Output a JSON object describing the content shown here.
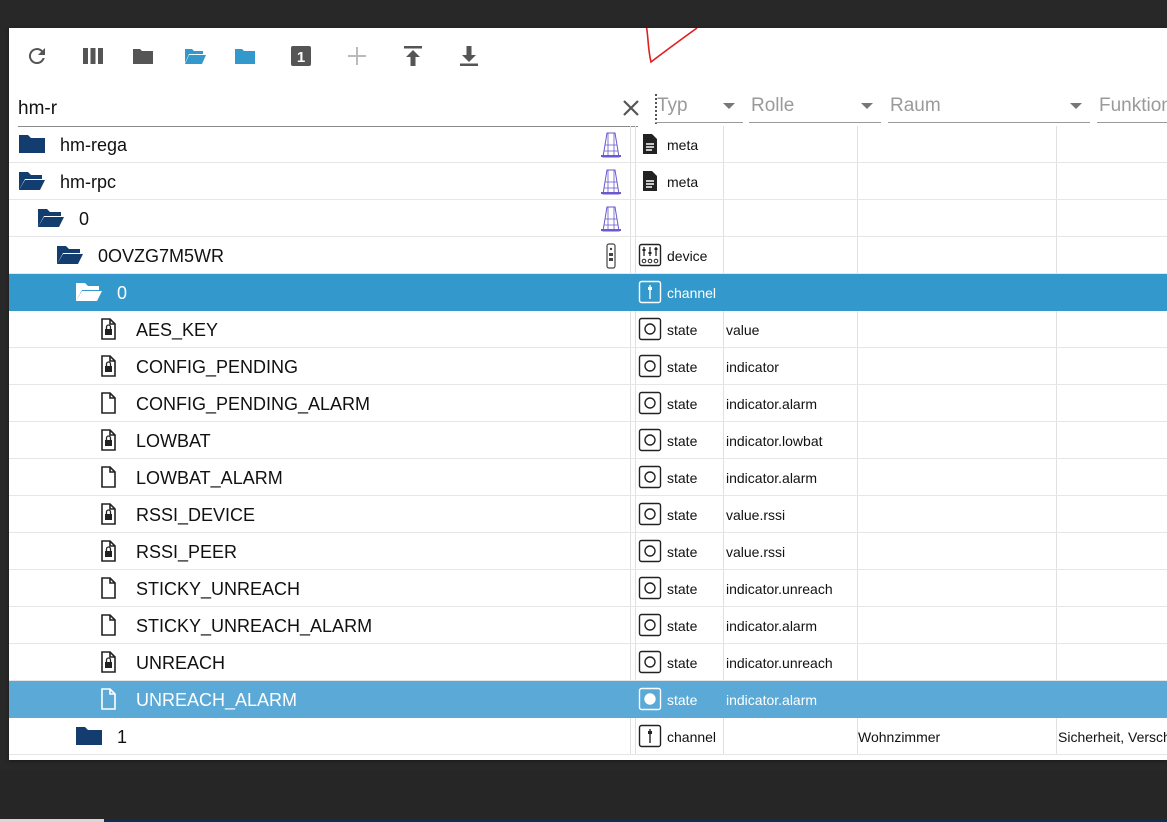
{
  "toolbar": {
    "buttons": [
      {
        "name": "refresh",
        "icon": "refresh-icon"
      },
      {
        "name": "columns",
        "icon": "columns-icon"
      },
      {
        "name": "collapse-all",
        "icon": "folder-closed-icon"
      },
      {
        "name": "expand-all",
        "icon": "folder-open-icon"
      },
      {
        "name": "expand-one",
        "icon": "folder-blue-icon"
      },
      {
        "name": "level",
        "icon": "number-one-icon",
        "label": "1"
      },
      {
        "name": "add",
        "icon": "plus-icon"
      },
      {
        "name": "upload",
        "icon": "upload-icon"
      },
      {
        "name": "download",
        "icon": "download-icon"
      }
    ]
  },
  "search": {
    "value": "hm-r"
  },
  "filters": {
    "type_placeholder": "Typ",
    "role_placeholder": "Rolle",
    "room_placeholder": "Raum",
    "function_placeholder": "Funktion"
  },
  "colors": {
    "folder": "#123d6e",
    "selected_dark": "#3399cc",
    "selected_light": "#5aa9d6",
    "annotation": "#e02020"
  },
  "rows": [
    {
      "name": "hm-rega",
      "kind": "folder-closed",
      "type": "meta",
      "type_icon": "document-icon",
      "role": "",
      "room": "",
      "func": "",
      "adapter_icon": "rega-icon"
    },
    {
      "name": "hm-rpc",
      "kind": "folder-open",
      "type": "meta",
      "type_icon": "document-icon",
      "role": "",
      "room": "",
      "func": "",
      "adapter_icon": "rpc-icon"
    },
    {
      "name": "0",
      "kind": "folder-open",
      "type": "",
      "type_icon": "",
      "role": "",
      "room": "",
      "func": "",
      "adapter_icon": "rpc-icon"
    },
    {
      "name": "0OVZG7M5WR",
      "kind": "folder-open",
      "type": "device",
      "type_icon": "device-icon",
      "role": "",
      "room": "",
      "func": "",
      "adapter_icon": "device-remote-icon"
    },
    {
      "name": "0",
      "kind": "folder-open",
      "type": "channel",
      "type_icon": "channel-icon",
      "role": "",
      "room": "",
      "func": "",
      "selected": "dark"
    },
    {
      "name": "AES_KEY",
      "kind": "file-lock",
      "type": "state",
      "type_icon": "state-icon",
      "role": "value",
      "room": "",
      "func": ""
    },
    {
      "name": "CONFIG_PENDING",
      "kind": "file-lock",
      "type": "state",
      "type_icon": "state-icon",
      "role": "indicator",
      "room": "",
      "func": ""
    },
    {
      "name": "CONFIG_PENDING_ALARM",
      "kind": "file",
      "type": "state",
      "type_icon": "state-icon",
      "role": "indicator.alarm",
      "room": "",
      "func": ""
    },
    {
      "name": "LOWBAT",
      "kind": "file-lock",
      "type": "state",
      "type_icon": "state-icon",
      "role": "indicator.lowbat",
      "room": "",
      "func": ""
    },
    {
      "name": "LOWBAT_ALARM",
      "kind": "file",
      "type": "state",
      "type_icon": "state-icon",
      "role": "indicator.alarm",
      "room": "",
      "func": ""
    },
    {
      "name": "RSSI_DEVICE",
      "kind": "file-lock",
      "type": "state",
      "type_icon": "state-icon",
      "role": "value.rssi",
      "room": "",
      "func": ""
    },
    {
      "name": "RSSI_PEER",
      "kind": "file-lock",
      "type": "state",
      "type_icon": "state-icon",
      "role": "value.rssi",
      "room": "",
      "func": ""
    },
    {
      "name": "STICKY_UNREACH",
      "kind": "file",
      "type": "state",
      "type_icon": "state-icon",
      "role": "indicator.unreach",
      "room": "",
      "func": ""
    },
    {
      "name": "STICKY_UNREACH_ALARM",
      "kind": "file",
      "type": "state",
      "type_icon": "state-icon",
      "role": "indicator.alarm",
      "room": "",
      "func": ""
    },
    {
      "name": "UNREACH",
      "kind": "file-lock",
      "type": "state",
      "type_icon": "state-icon",
      "role": "indicator.unreach",
      "room": "",
      "func": ""
    },
    {
      "name": "UNREACH_ALARM",
      "kind": "file",
      "type": "state",
      "type_icon": "state-icon",
      "role": "indicator.alarm",
      "room": "",
      "func": "",
      "selected": "light"
    },
    {
      "name": "1",
      "kind": "folder-closed",
      "type": "channel",
      "type_icon": "channel-icon",
      "role": "",
      "room": "Wohnzimmer",
      "func": "Sicherheit, Verschl",
      "adapter_icon": ""
    }
  ]
}
